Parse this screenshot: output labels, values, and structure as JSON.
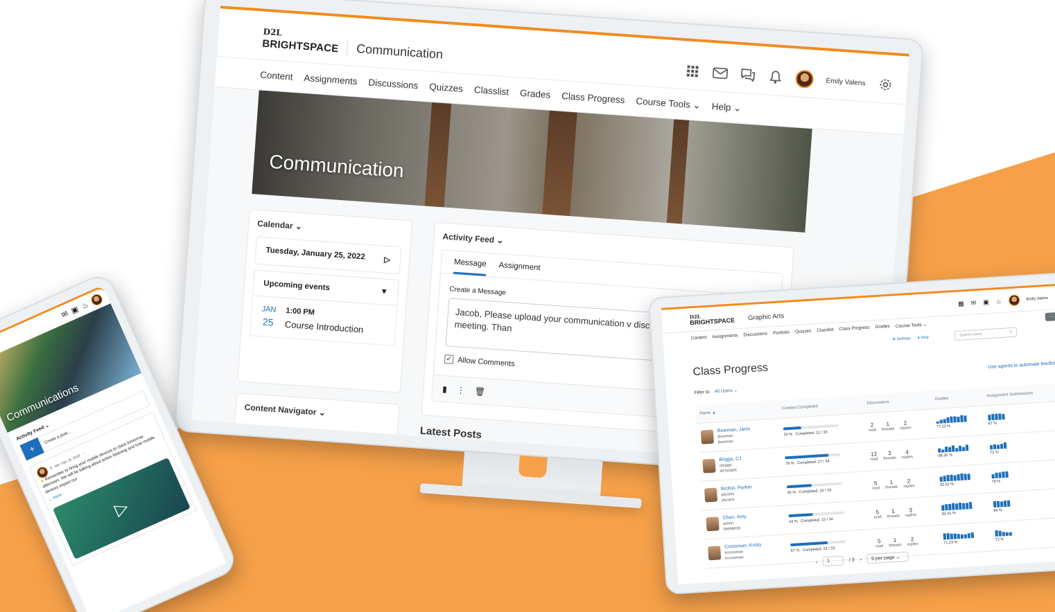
{
  "colors": {
    "brand_orange": "#f28b1e",
    "background_orange": "#f6a14a",
    "link_blue": "#1e6fbb"
  },
  "monitor": {
    "brand_top": "D2L",
    "brand_name": "BRIGHTSPACE",
    "course": "Communication",
    "user_name": "Emily Valens",
    "icons": [
      "apps-grid-icon",
      "mail-icon",
      "chat-icon",
      "bell-icon",
      "gear-icon"
    ],
    "nav": [
      "Content",
      "Assignments",
      "Discussions",
      "Quizzes",
      "Classlist",
      "Grades",
      "Class Progress",
      "Course Tools",
      "Help"
    ],
    "hero_title": "Communication",
    "calendar": {
      "title": "Calendar",
      "date": "Tuesday, January 25, 2022",
      "upcoming": "Upcoming events",
      "event_month": "JAN",
      "event_day": "25",
      "event_time": "1:00 PM",
      "event_name": "Course Introduction"
    },
    "content_navigator": "Content Navigator",
    "activity_feed": {
      "title": "Activity Feed",
      "tab_message": "Message",
      "tab_assignment": "Assignment",
      "create_label": "Create a Message",
      "message_text": "Jacob, Please upload your communication v discuss as a team in the next meeting. Than",
      "allow_comments": "Allow Comments"
    },
    "latest_posts": "Latest Posts"
  },
  "tablet": {
    "brand_top": "D2L",
    "brand_name": "BRIGHTSPACE",
    "course": "Graphic Arts",
    "user_name": "Emily Valens",
    "nav": [
      "Content",
      "Assignments",
      "Discussions",
      "Portfolio",
      "Quizzes",
      "Classlist",
      "Class Progress",
      "Grades",
      "Course Tools"
    ],
    "more": "...",
    "settings": "Settings",
    "help": "Help",
    "search_placeholder": "Search users",
    "title": "Class Progress",
    "filter_label": "Filter to:",
    "filter_value": "All Users",
    "agents_link": "Use agents to automate feedback",
    "columns": [
      "Name",
      "Content Completed",
      "Discussions",
      "Grades",
      "Assignment Submissions"
    ],
    "disc_labels": [
      "read",
      "threads",
      "replies"
    ],
    "rows": [
      {
        "name": "Bowman, Janis",
        "id1": "jbowman",
        "id2": "jbowman",
        "pct": "33 %",
        "completed": "Completed: 11 / 33",
        "fill": 0.33,
        "read": "2",
        "threads": "1",
        "replies": "2",
        "grade": "77.22 %",
        "sub": "87 %"
      },
      {
        "name": "Briggs, CJ",
        "id1": "cbriggs",
        "id2": "45745665",
        "pct": "79 %",
        "completed": "Completed: 27 / 34",
        "fill": 0.79,
        "read": "12",
        "threads": "3",
        "replies": "4",
        "grade": "68.35 %",
        "sub": "72 %"
      },
      {
        "name": "Brobst, Parker",
        "id1": "pbrobst",
        "id2": "pbrobst",
        "pct": "45 %",
        "completed": "Completed: 15 / 33",
        "fill": 0.45,
        "read": "5",
        "threads": "1",
        "replies": "2",
        "grade": "82.91 %",
        "sub": "79 %"
      },
      {
        "name": "Chen, Amy",
        "id1": "achen",
        "id2": "59698639",
        "pct": "44 %",
        "completed": "Completed: 15 / 34",
        "fill": 0.44,
        "read": "5",
        "threads": "1",
        "replies": "3",
        "grade": "92.41 %",
        "sub": "94 %"
      },
      {
        "name": "Crossman, Kristy",
        "id1": "kcrossman",
        "id2": "kcrossman",
        "pct": "67 %",
        "completed": "Completed: 22 / 33",
        "fill": 0.67,
        "read": "5",
        "threads": "1",
        "replies": "2",
        "grade": "71.23 %",
        "sub": "72 %"
      }
    ],
    "pager_page": "1",
    "pager_total": "/ 3",
    "per_page": "5 per page"
  },
  "phone": {
    "hero_title": "Communications",
    "feed_title": "Activity Feed",
    "create_post": "Create a post...",
    "post_meta": "Me • Apr 16, 2019",
    "post_text": "Remember to bring your mobile devices to class tomorrow afternoon. We will be talking about active listening and how mobile devices impact our",
    "more": "more"
  }
}
